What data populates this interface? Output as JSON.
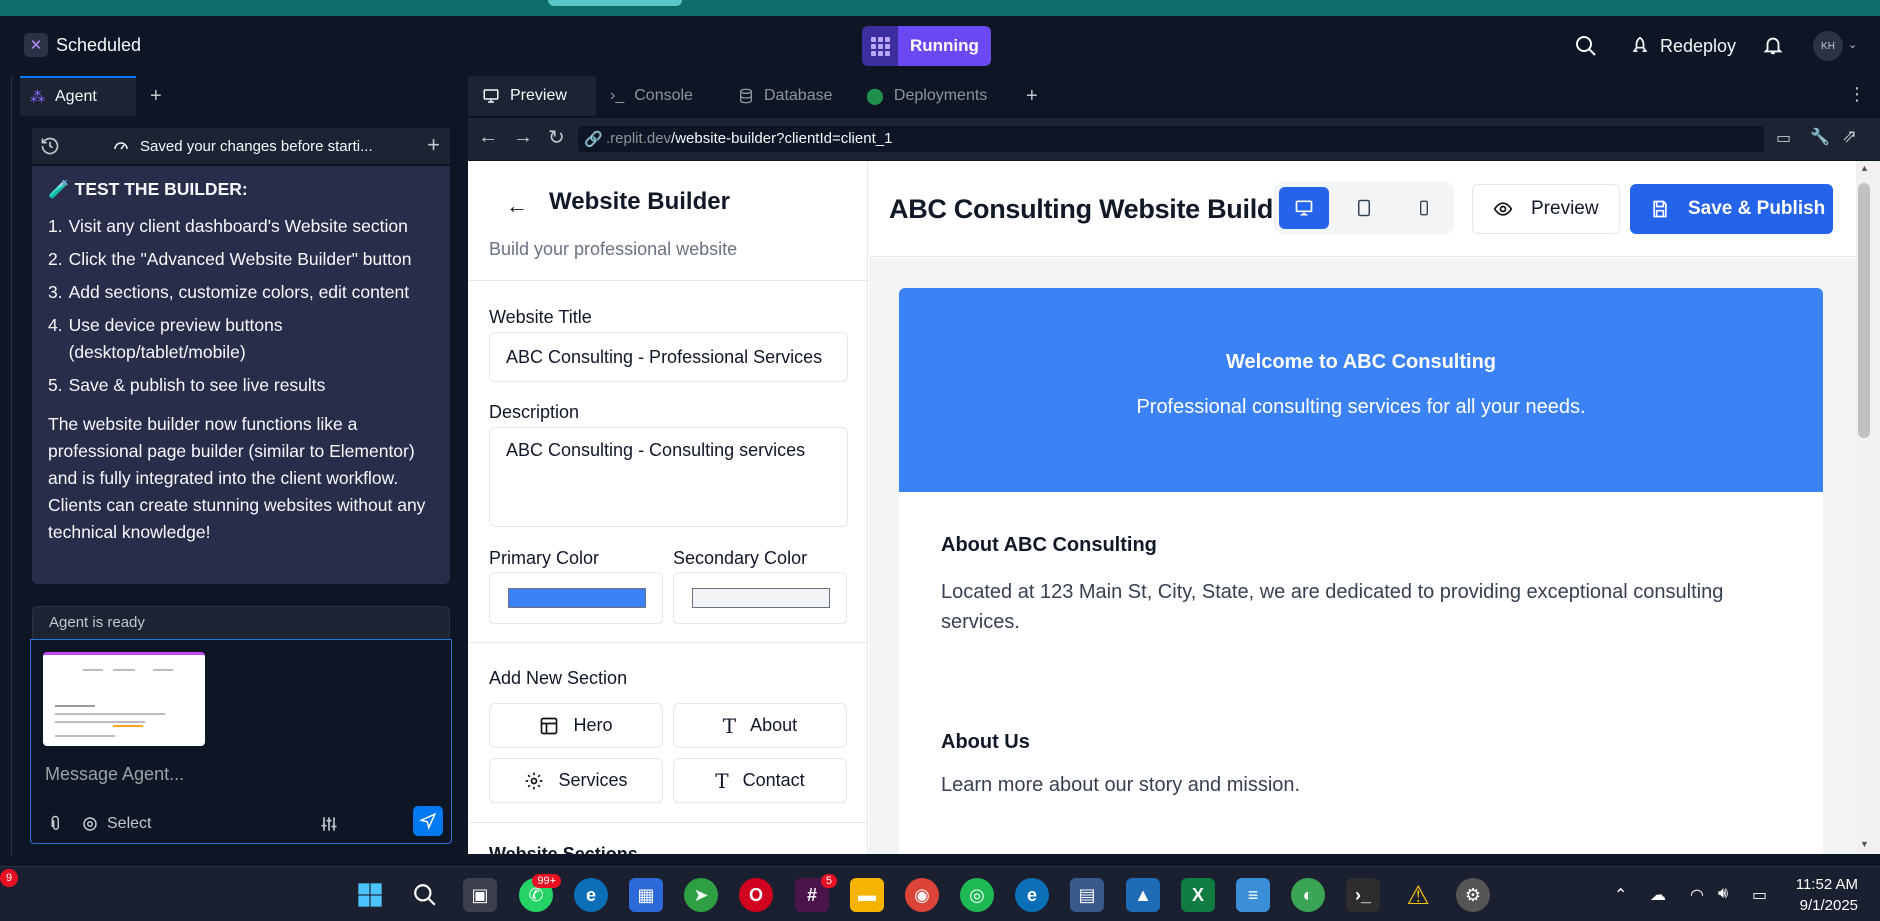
{
  "app": {
    "name": "Scheduled",
    "status": "Running",
    "redeploy": "Redeploy",
    "avatar": "KH"
  },
  "agent_pane": {
    "tab_label": "Agent",
    "toolbar_status": "Saved your changes before starti...",
    "message": {
      "heading": "🧪 TEST THE BUILDER:",
      "steps": [
        {
          "num": "1.",
          "text": "Visit any client dashboard's Website section"
        },
        {
          "num": "2.",
          "text": "Click the \"Advanced Website Builder\" button"
        },
        {
          "num": "3.",
          "text": "Add sections, customize colors, edit content"
        },
        {
          "num": "4.",
          "text": "Use device preview buttons (desktop/tablet/mobile)"
        },
        {
          "num": "5.",
          "text": "Save & publish to see live results"
        }
      ],
      "summary": "The website builder now functions like a professional page builder (similar to Elementor) and is fully integrated into the client workflow. Clients can create stunning websites without any technical knowledge!"
    },
    "agent_status": "Agent is ready",
    "input_placeholder": "Message Agent...",
    "select_label": "Select"
  },
  "workspace": {
    "tabs": [
      "Preview",
      "Console",
      "Database",
      "Deployments"
    ],
    "url_prefix": ".replit.dev",
    "url_path": "/website-builder?clientId=client_1"
  },
  "builder": {
    "title": "Website Builder",
    "subtitle": "Build your professional website",
    "website_title_label": "Website Title",
    "website_title_value": "ABC Consulting - Professional Services",
    "description_label": "Description",
    "description_value": "ABC Consulting - Consulting services",
    "primary_color_label": "Primary Color",
    "secondary_color_label": "Secondary Color",
    "primary_color": "#3b82f6",
    "secondary_color": "#f3f4f6",
    "add_section_label": "Add New Section",
    "section_buttons": {
      "hero": "Hero",
      "about": "About",
      "services": "Services",
      "contact": "Contact"
    },
    "sections_label": "Website Sections",
    "main_title": "ABC Consulting Website Builder",
    "preview_button": "Preview",
    "publish_button": "Save & Publish"
  },
  "site_preview": {
    "hero_title": "Welcome to ABC Consulting",
    "hero_subtitle": "Professional consulting services for all your needs.",
    "about_title": "About ABC Consulting",
    "about_text": "Located at 123 Main St, City, State, we are dedicated to providing exceptional consulting services.",
    "about_us_title": "About Us",
    "about_us_text": "Learn more about our story and mission."
  },
  "taskbar": {
    "notif_count": "9",
    "whatsapp_badge": "99+",
    "slack_badge": "5",
    "time": "11:52 AM",
    "date": "9/1/2025"
  }
}
